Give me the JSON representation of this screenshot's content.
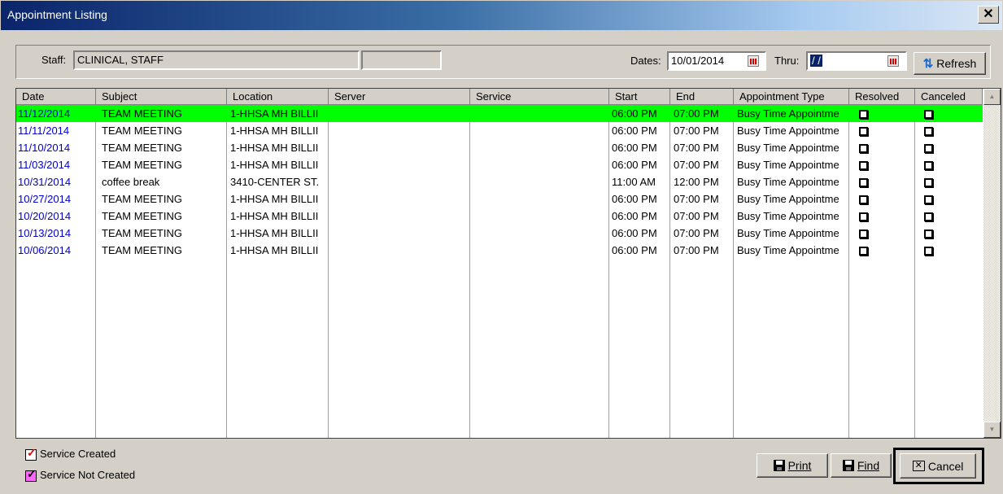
{
  "window": {
    "title": "Appointment Listing",
    "close_label": "✕"
  },
  "filter": {
    "staff_label": "Staff:",
    "staff_value": "CLINICAL, STAFF",
    "staff_extra": "",
    "dates_label": "Dates:",
    "date_from": "10/01/2014",
    "thru_label": "Thru:",
    "date_thru": " / / ",
    "refresh_label": "Refresh"
  },
  "grid": {
    "columns": [
      "Date",
      "Subject",
      "Location",
      "Server",
      "Service",
      "Start",
      "End",
      "Appointment Type",
      "Resolved",
      "Canceled"
    ],
    "rows": [
      {
        "date": "11/12/2014",
        "subject": "TEAM MEETING",
        "location": "1-HHSA MH BILLII",
        "server": "",
        "service": "",
        "start": "06:00 PM",
        "end": "07:00 PM",
        "type": "Busy Time Appointme",
        "resolved": false,
        "canceled": false,
        "selected": true
      },
      {
        "date": "11/11/2014",
        "subject": "TEAM MEETING",
        "location": "1-HHSA MH BILLII",
        "server": "",
        "service": "",
        "start": "06:00 PM",
        "end": "07:00 PM",
        "type": "Busy Time Appointme",
        "resolved": false,
        "canceled": false,
        "selected": false
      },
      {
        "date": "11/10/2014",
        "subject": "TEAM MEETING",
        "location": "1-HHSA MH BILLII",
        "server": "",
        "service": "",
        "start": "06:00 PM",
        "end": "07:00 PM",
        "type": "Busy Time Appointme",
        "resolved": false,
        "canceled": false,
        "selected": false
      },
      {
        "date": "11/03/2014",
        "subject": "TEAM MEETING",
        "location": "1-HHSA MH BILLII",
        "server": "",
        "service": "",
        "start": "06:00 PM",
        "end": "07:00 PM",
        "type": "Busy Time Appointme",
        "resolved": false,
        "canceled": false,
        "selected": false
      },
      {
        "date": "10/31/2014",
        "subject": "coffee break",
        "location": "3410-CENTER ST.",
        "server": "",
        "service": "",
        "start": "11:00 AM",
        "end": "12:00 PM",
        "type": "Busy Time Appointme",
        "resolved": false,
        "canceled": false,
        "selected": false
      },
      {
        "date": "10/27/2014",
        "subject": "TEAM MEETING",
        "location": "1-HHSA MH BILLII",
        "server": "",
        "service": "",
        "start": "06:00 PM",
        "end": "07:00 PM",
        "type": "Busy Time Appointme",
        "resolved": false,
        "canceled": false,
        "selected": false
      },
      {
        "date": "10/20/2014",
        "subject": "TEAM MEETING",
        "location": "1-HHSA MH BILLII",
        "server": "",
        "service": "",
        "start": "06:00 PM",
        "end": "07:00 PM",
        "type": "Busy Time Appointme",
        "resolved": false,
        "canceled": false,
        "selected": false
      },
      {
        "date": "10/13/2014",
        "subject": "TEAM MEETING",
        "location": "1-HHSA MH BILLII",
        "server": "",
        "service": "",
        "start": "06:00 PM",
        "end": "07:00 PM",
        "type": "Busy Time Appointme",
        "resolved": false,
        "canceled": false,
        "selected": false
      },
      {
        "date": "10/06/2014",
        "subject": "TEAM MEETING",
        "location": "1-HHSA MH BILLII",
        "server": "",
        "service": "",
        "start": "06:00 PM",
        "end": "07:00 PM",
        "type": "Busy Time Appointme",
        "resolved": false,
        "canceled": false,
        "selected": false
      }
    ]
  },
  "legend": {
    "created": "Service Created",
    "not_created": "Service Not Created"
  },
  "buttons": {
    "print": "Print",
    "find": "Find",
    "cancel": "Cancel"
  },
  "icons": {
    "refresh": "refresh-icon",
    "print": "floppy-disk-icon",
    "find": "floppy-disk-icon",
    "cancel": "x-box-icon"
  },
  "colors": {
    "selected_row": "#00ff00",
    "date_text": "#0000cc",
    "title_start": "#0a246a"
  }
}
